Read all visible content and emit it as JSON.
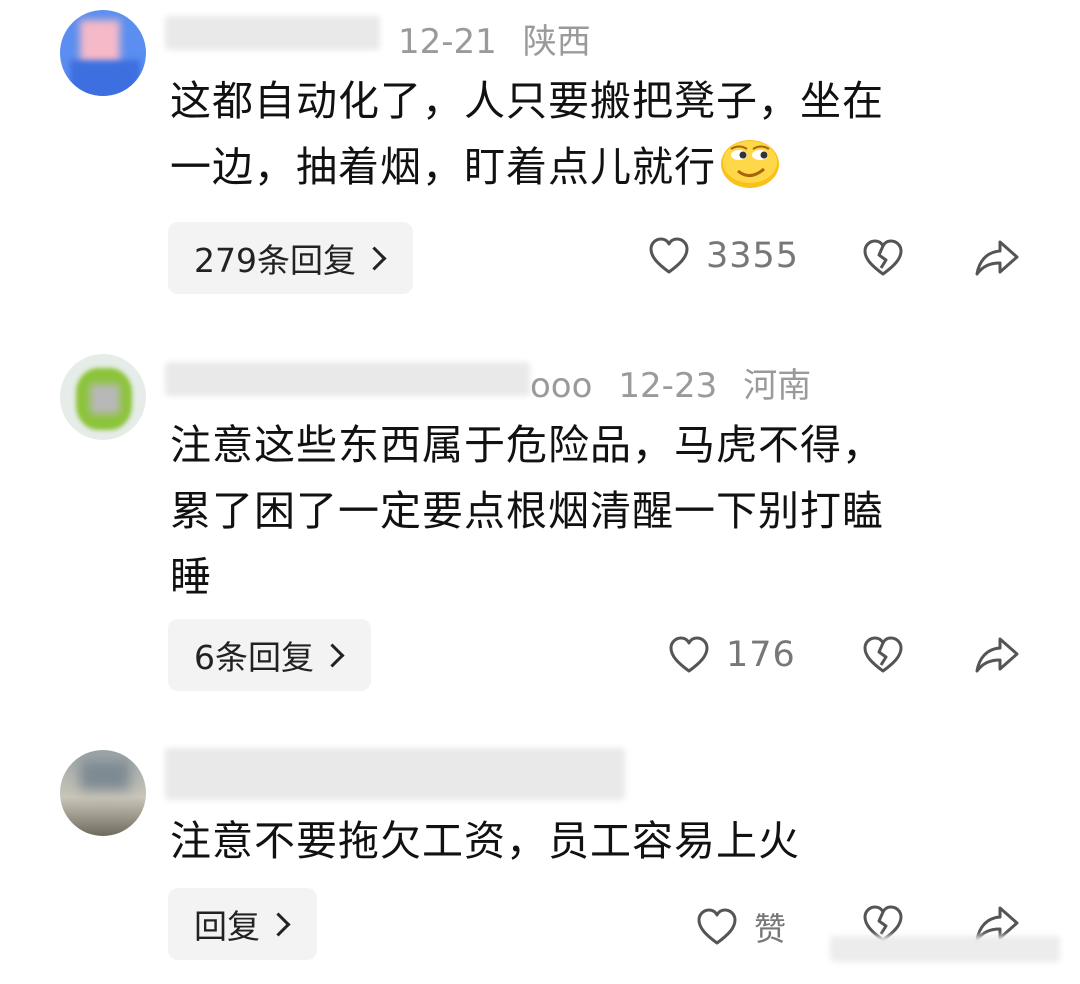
{
  "comments": [
    {
      "date": "12-21",
      "location": "陕西",
      "text_lines": [
        "这都自动化了，人只要搬把凳子，坐在",
        "一边，抽着烟，盯着点儿就行"
      ],
      "emoji": "sly-smile-emoji",
      "reply_label": "279条回复",
      "likes": "3355"
    },
    {
      "username_tail": "ooo",
      "date": "12-23",
      "location": "河南",
      "text_lines": [
        "注意这些东西属于危险品，马虎不得，",
        "累了困了一定要点根烟清醒一下别打瞌",
        "睡"
      ],
      "reply_label": "6条回复",
      "likes": "176"
    },
    {
      "text_lines": [
        "注意不要拖欠工资，员工容易上火"
      ],
      "reply_label": "回复",
      "likes": "赞"
    }
  ],
  "icons": {
    "like": "heart-outline-icon",
    "dislike": "broken-heart-icon",
    "share": "share-arrow-icon",
    "chevron": "chevron-right-icon"
  },
  "colors": {
    "meta_text": "#9a9a9a",
    "button_bg": "#f3f3f3",
    "icon_stroke": "#444444"
  }
}
